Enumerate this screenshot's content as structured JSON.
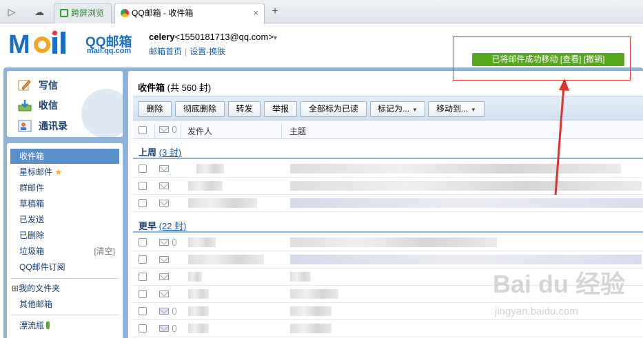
{
  "browser": {
    "tabs": [
      {
        "label": "跨屏浏览"
      },
      {
        "label": "QQ邮箱 - 收件箱",
        "close": "×"
      }
    ],
    "new_tab": "+"
  },
  "header": {
    "brand": "QQ邮箱",
    "brand_sub": "mail.qq.com",
    "user_name": "celery",
    "user_email": "<1550181713@qq.com>",
    "user_menu_arrow": "▾",
    "links": [
      "邮箱首页",
      "设置",
      "换肤"
    ],
    "link_sep": "|",
    "link_sep2": "-"
  },
  "notice": {
    "text": "已将邮件成功移动",
    "view": "[查看]",
    "undo": "[撤销]"
  },
  "sidebar": {
    "actions": [
      {
        "label": "写信",
        "icon": "write-icon"
      },
      {
        "label": "收信",
        "icon": "receive-icon"
      },
      {
        "label": "通讯录",
        "icon": "contacts-icon"
      }
    ],
    "folders": [
      {
        "label": "收件箱",
        "active": true
      },
      {
        "label": "星标邮件",
        "icon": "star-icon"
      },
      {
        "label": "群邮件"
      },
      {
        "label": "草稿箱"
      },
      {
        "label": "已发送"
      },
      {
        "label": "已删除"
      },
      {
        "label": "垃圾箱",
        "extra": "[清空]"
      },
      {
        "label": "QQ邮件订阅"
      }
    ],
    "my_folders": "我的文件夹",
    "my_folders_toggle": "⊞",
    "other_mail": "其他邮箱",
    "drift_bottle": "漂流瓶"
  },
  "main": {
    "title": "收件箱",
    "title_count": "(共 560 封)",
    "toolbar": {
      "delete": "删除",
      "purge": "彻底删除",
      "forward": "转发",
      "report": "举报",
      "mark_all_read": "全部标为已读",
      "mark_as": "标记为...",
      "move_to": "移动到..."
    },
    "columns": {
      "sender": "发件人",
      "subject": "主题"
    },
    "groups": [
      {
        "label": "上周",
        "count": "(3 封)"
      },
      {
        "label": "更早",
        "count": "(22 封)"
      }
    ]
  },
  "watermark": {
    "text": "Bai du 经验",
    "sub": "jingyan.baidu.com"
  },
  "colors": {
    "accent": "#1a6fc4",
    "notice_bg": "#58a81c",
    "annotation": "#e03030",
    "frame": "#8fb2d8",
    "active_folder": "#5b8fcc"
  }
}
